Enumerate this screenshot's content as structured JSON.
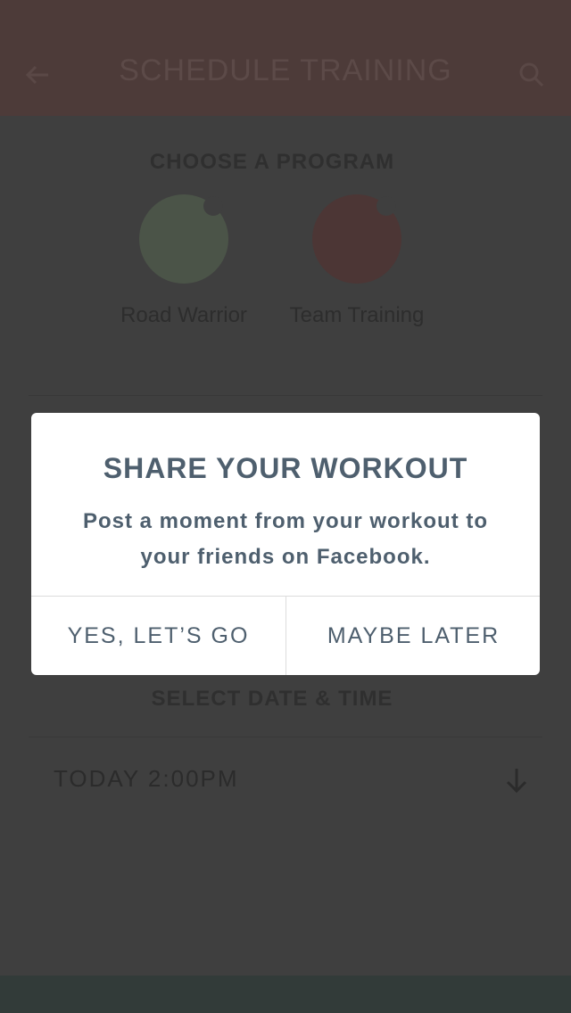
{
  "header": {
    "title": "SCHEDULE TRAINING",
    "back_icon": "arrow-left-icon",
    "search_icon": "search-icon"
  },
  "program": {
    "heading": "CHOOSE A PROGRAM",
    "items": [
      {
        "label": "Road Warrior",
        "color": "#4b5448"
      },
      {
        "label": "Team Training",
        "color": "#4c3635"
      }
    ]
  },
  "date": {
    "heading": "SELECT DATE & TIME",
    "value": "TODAY 2:00PM",
    "icon": "arrow-down-icon"
  },
  "modal": {
    "title": "SHARE YOUR WORKOUT",
    "message": "Post a moment from your workout to your friends on Facebook.",
    "yes_label": "YES, LET’S GO",
    "later_label": "MAYBE LATER"
  },
  "colors": {
    "overlay_bg": "#3f3f3f",
    "header_bg": "#4d3b39",
    "modal_text": "#4e5f6e",
    "bottom_bar": "#323b39"
  }
}
